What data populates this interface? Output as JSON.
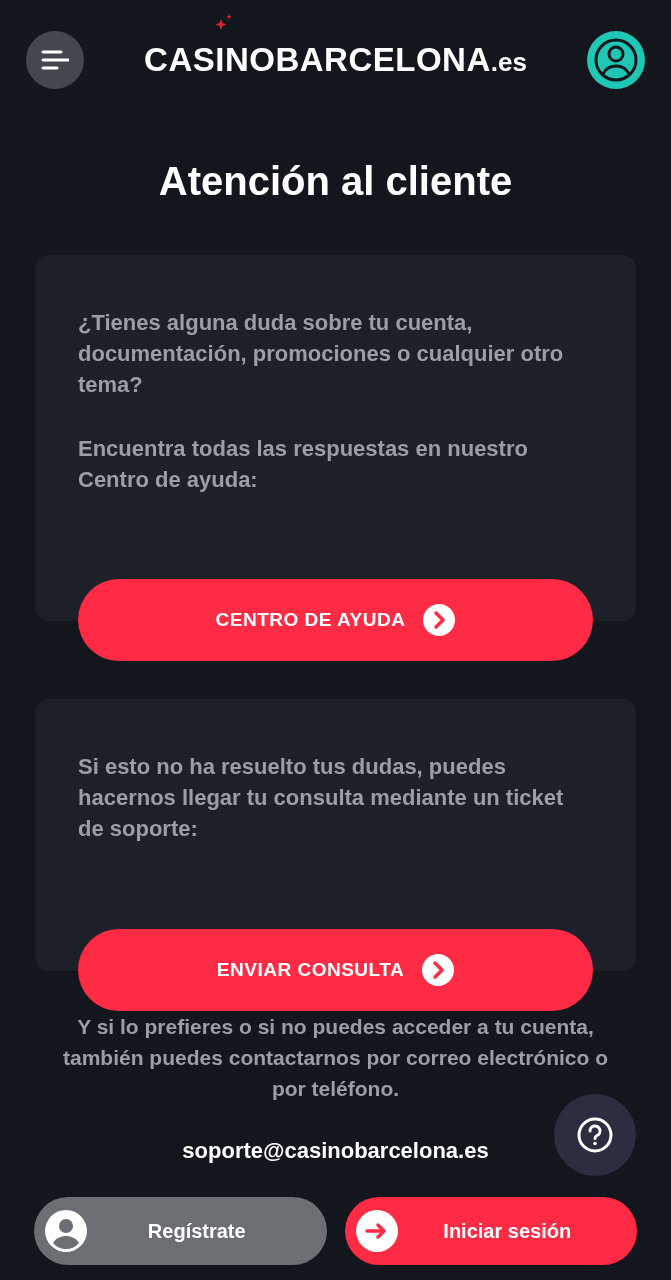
{
  "header": {
    "logo": "CASINOBARCELONA",
    "logo_suffix": ".es"
  },
  "title": "Atención al cliente",
  "cards": [
    {
      "paragraphs": [
        "¿Tienes alguna duda sobre tu cuenta, documentación, promociones o cualquier otro tema?",
        "Encuentra todas las respuestas en nuestro Centro de ayuda:"
      ],
      "button": "CENTRO DE AYUDA"
    },
    {
      "paragraphs": [
        "Si esto no ha resuelto tus dudas, puedes hacernos llegar tu consulta mediante un ticket de soporte:"
      ],
      "button": "ENVIAR CONSULTA"
    }
  ],
  "contact_text": "Y si lo prefieres o si no puedes acceder a tu cuenta, también puedes contactarnos por correo electrónico o por teléfono.",
  "email": "soporte@casinobarcelona.es",
  "bottom_bar": [
    {
      "kind": "register",
      "label": "Regístrate"
    },
    {
      "kind": "login",
      "label": "Iniciar sesión"
    }
  ]
}
